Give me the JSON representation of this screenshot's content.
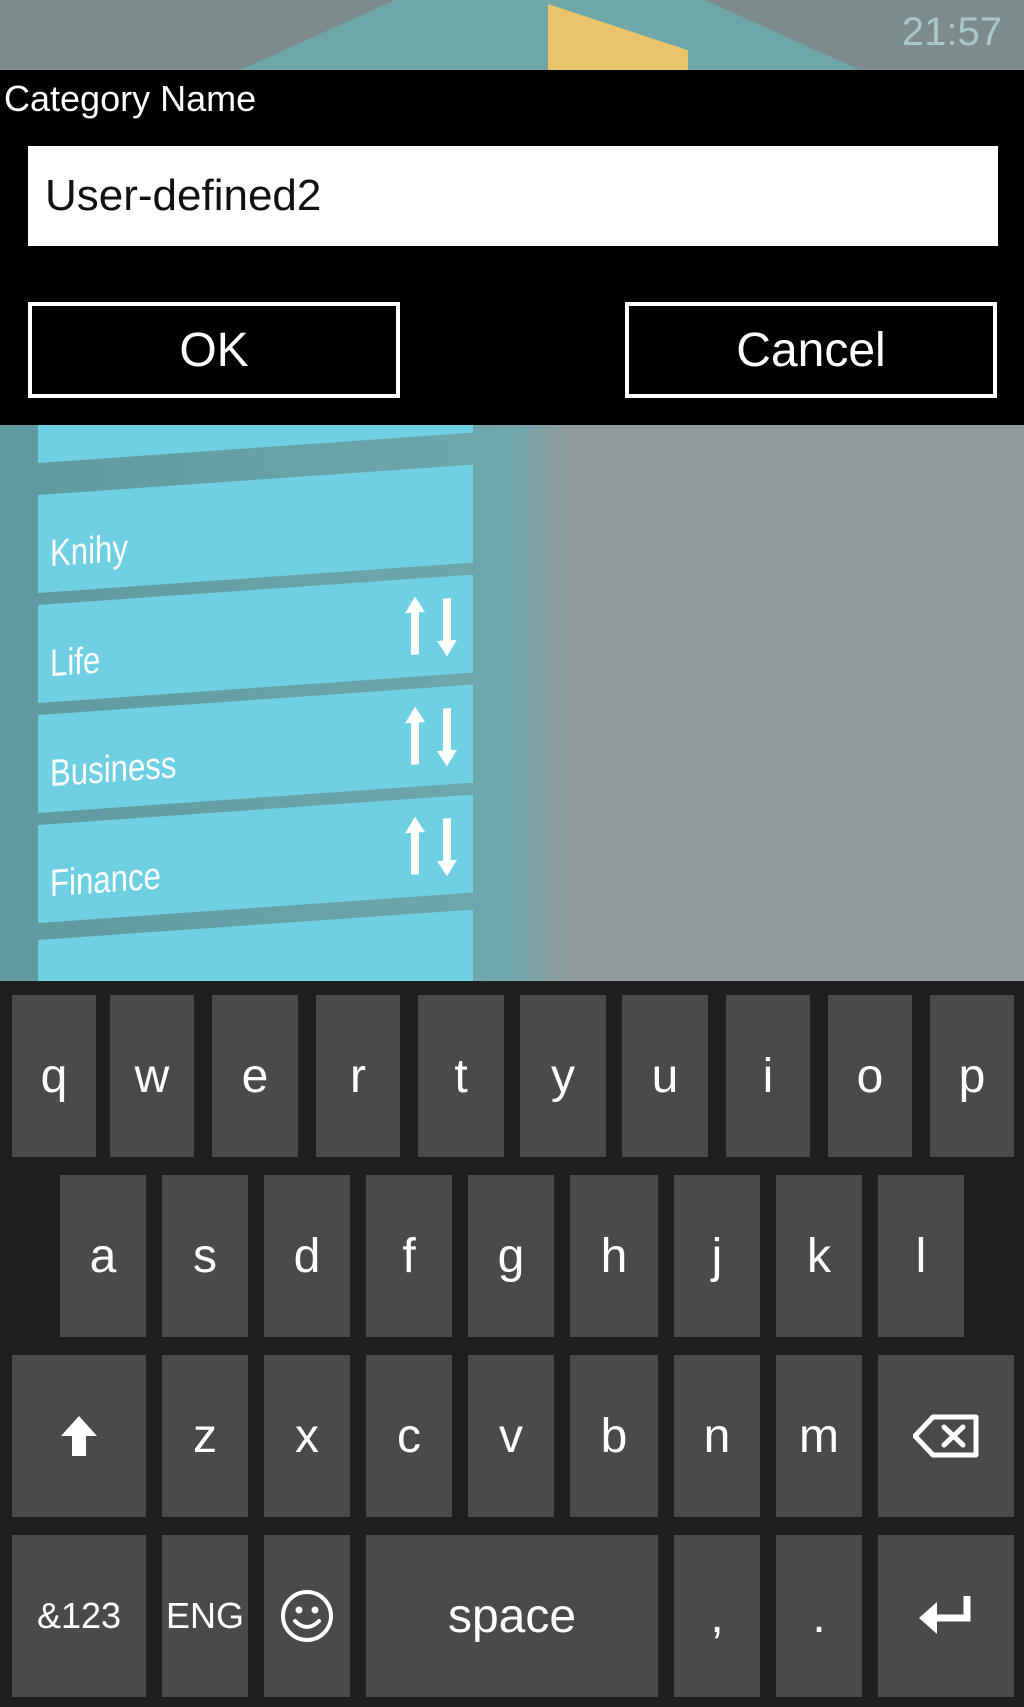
{
  "status_bar": {
    "time": "21:57"
  },
  "background_list": {
    "items": [
      {
        "label": ""
      },
      {
        "label": "Knihy"
      },
      {
        "label": "Life"
      },
      {
        "label": "Business"
      },
      {
        "label": "Finance"
      },
      {
        "label": ""
      }
    ]
  },
  "dialog": {
    "title": "Category Name",
    "input_value": "User-defined2",
    "ok_label": "OK",
    "cancel_label": "Cancel"
  },
  "keyboard": {
    "row1": [
      "q",
      "w",
      "e",
      "r",
      "t",
      "y",
      "u",
      "i",
      "o",
      "p"
    ],
    "row2": [
      "a",
      "s",
      "d",
      "f",
      "g",
      "h",
      "j",
      "k",
      "l"
    ],
    "row3": [
      "z",
      "x",
      "c",
      "v",
      "b",
      "n",
      "m"
    ],
    "symbols_label": "&123",
    "language_label": "ENG",
    "space_label": "space",
    "comma_label": ",",
    "period_label": "."
  },
  "colors": {
    "dialog_bg": "#000000",
    "key_bg": "#4a4a4a",
    "keyboard_bg": "#1f1f1f",
    "list_item_bg": "#6fd0e3"
  }
}
